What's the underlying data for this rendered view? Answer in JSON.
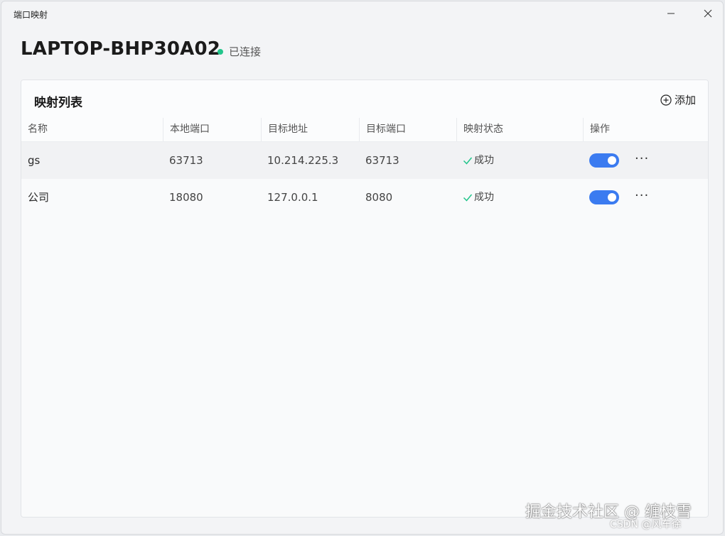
{
  "window": {
    "title": "端口映射"
  },
  "device": {
    "name": "LAPTOP-BHP30A02",
    "status": "已连接",
    "status_color": "#22c58b"
  },
  "card": {
    "title": "映射列表",
    "add_label": "添加"
  },
  "table": {
    "columns": [
      "名称",
      "本地端口",
      "目标地址",
      "目标端口",
      "映射状态",
      "操作"
    ],
    "rows": [
      {
        "name": "gs",
        "local_port": "63713",
        "target_address": "10.214.225.3",
        "target_port": "63713",
        "status": "成功",
        "enabled": true
      },
      {
        "name": "公司",
        "local_port": "18080",
        "target_address": "127.0.0.1",
        "target_port": "8080",
        "status": "成功",
        "enabled": true
      }
    ]
  },
  "watermark": {
    "line1": "掘金技术社区 @ 缠枝雪",
    "line2": "CSDN @风车徐"
  },
  "colors": {
    "toggle_on": "#3b7bf0",
    "success_check": "#22c58b"
  }
}
